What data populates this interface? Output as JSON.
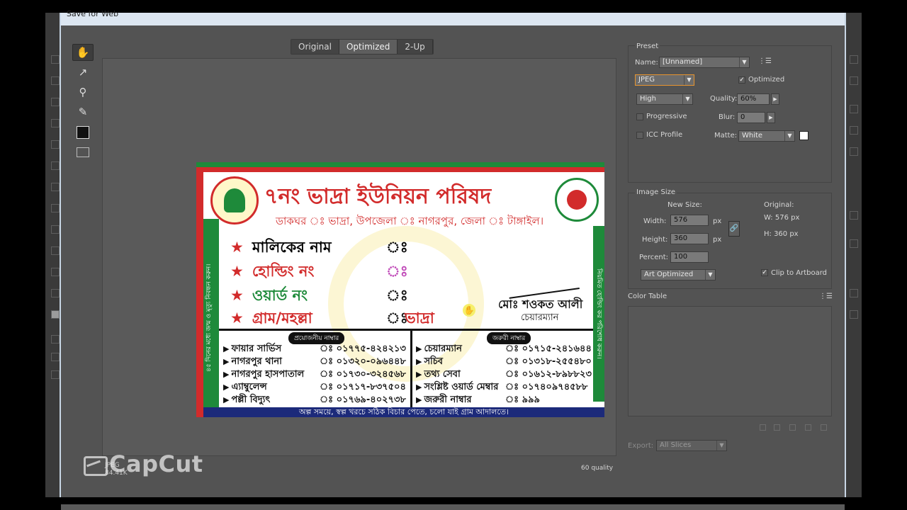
{
  "dialog": {
    "title": "Save for Web"
  },
  "tabs": [
    "Original",
    "Optimized",
    "2-Up"
  ],
  "image": {
    "title": "৭নং ভাদ্রা ইউনিয়ন পরিষদ",
    "address": "ডাকঘর ঃ ভাদ্রা, উপজেলা ঃ নাগরপুর, জেলা ঃ টাঙ্গাইল।",
    "fields": [
      {
        "label": "মালিকের নাম",
        "value": "",
        "color": "#111111"
      },
      {
        "label": "হোল্ডিং নং",
        "value": "",
        "color": "#d22b2b"
      },
      {
        "label": "ওয়ার্ড নং",
        "value": "",
        "color": "#1e8a3a"
      },
      {
        "label": "গ্রাম/মহল্লা",
        "value": "ভাদ্রা",
        "color": "#d22b2b"
      }
    ],
    "chairman_name": "মোঃ শওকত আলী",
    "chairman_title": "চেয়ারম্যান",
    "left_vertical": "৪৫ দিনের মধ্যে জন্ম ও মৃত্যু নিবন্ধন করুন।",
    "right_vertical": "নিয়মিত হোল্ডিং কর পরিশোধ করুন।",
    "left_table_head": "প্রয়োজনীয় নাম্বার",
    "right_table_head": "জরুরী নাম্বার",
    "left_rows": [
      {
        "name": "ফায়ার সার্ভিস",
        "phone": "ঃ ০১৭৭৫-৪২৪২১৩"
      },
      {
        "name": "নাগরপুর থানা",
        "phone": "ঃ ০১৩২০-০৯৬৪৪৮"
      },
      {
        "name": "নাগরপুর হাসপাতাল",
        "phone": "ঃ ০১৭৩০-৩২৪৫৬৮"
      },
      {
        "name": "এ্যাম্বুলেন্স",
        "phone": "ঃ ০১৭১৭-৮৩৭৫০৪"
      },
      {
        "name": "পল্লী বিদ্যুৎ",
        "phone": "ঃ ০১৭৬৯-৪০২৭৩৮"
      }
    ],
    "right_rows": [
      {
        "name": "চেয়ারম্যান",
        "phone": "ঃ ০১৭১৫-২৪১৬৪৪"
      },
      {
        "name": "সচিব",
        "phone": "ঃ ০১৩১৮-২৫৫৪৮০"
      },
      {
        "name": "তথ্য সেবা",
        "phone": "ঃ ০১৬১২-৮৯৮৮২৩"
      },
      {
        "name": "সংশ্লিষ্ট ওয়ার্ড মেম্বার",
        "phone": "ঃ ০১৭৪০৯৭৪৫৮৮"
      },
      {
        "name": "জরুরী নাম্বার",
        "phone": "ঃ ৯৯৯"
      }
    ],
    "footer": "অল্প সময়ে, স্বল্প খরচে সঠিক বিচার পেতে, চলো যাই গ্রাম আদালতে।"
  },
  "status": {
    "format": "JPEG",
    "size": "84.41K",
    "quality_readout": "60 quality"
  },
  "preset": {
    "section_label": "Preset",
    "name_label": "Name:",
    "name_value": "[Unnamed]",
    "format": "JPEG",
    "optimized_label": "Optimized",
    "optimized_checked": true,
    "compression": "High",
    "quality_label": "Quality:",
    "quality_value": "60%",
    "progressive_label": "Progressive",
    "blur_label": "Blur:",
    "blur_value": "0",
    "icc_label": "ICC Profile",
    "matte_label": "Matte:",
    "matte_value": "White"
  },
  "image_size": {
    "section_label": "Image Size",
    "new_size_label": "New Size:",
    "original_label": "Original:",
    "width_label": "Width:",
    "width_value": "576",
    "height_label": "Height:",
    "height_value": "360",
    "px": "px",
    "orig_w": "W:  576 px",
    "orig_h": "H:  360 px",
    "percent_label": "Percent:",
    "percent_value": "100",
    "resample": "Art Optimized",
    "clip_label": "Clip to Artboard",
    "clip_checked": true
  },
  "color_table": {
    "label": "Color Table"
  },
  "export": {
    "label": "Export:",
    "value": "All Slices"
  },
  "watermark": {
    "text": "CapCut"
  },
  "icons": [
    "hand-icon",
    "slice-select-icon",
    "zoom-icon",
    "eyedropper-icon",
    "eyedropper-color-swatch",
    "slice-visibility-icon",
    "panel-menu-icon",
    "link-icon"
  ],
  "colors": {
    "dialog_bg": "#535353",
    "accent_focus": "#e7952f",
    "card_red": "#d22b2b",
    "card_green": "#1e8a3a",
    "card_navy": "#1c2a7a"
  }
}
